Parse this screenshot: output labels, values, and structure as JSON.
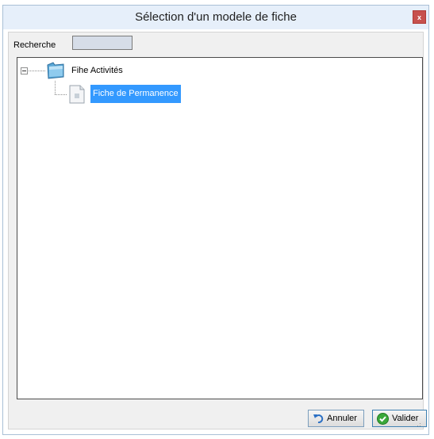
{
  "window": {
    "title": "Sélection d'un modele de fiche",
    "close_label": "x"
  },
  "search": {
    "label": "Recherche",
    "value": ""
  },
  "tree": {
    "root": {
      "label": "Fihe Activités",
      "icon": "folder-icon",
      "expanded": true
    },
    "children": [
      {
        "label": "Fiche de Permanence",
        "icon": "document-icon",
        "selected": true
      }
    ]
  },
  "buttons": {
    "cancel_label": "Annuler",
    "cancel_icon": "undo-icon",
    "ok_label": "Valider",
    "ok_icon": "check-icon"
  },
  "colors": {
    "title_bar": "#e6effa",
    "close_button": "#c7514d",
    "selection": "#3399ff",
    "check_icon": "#3aa83a"
  }
}
